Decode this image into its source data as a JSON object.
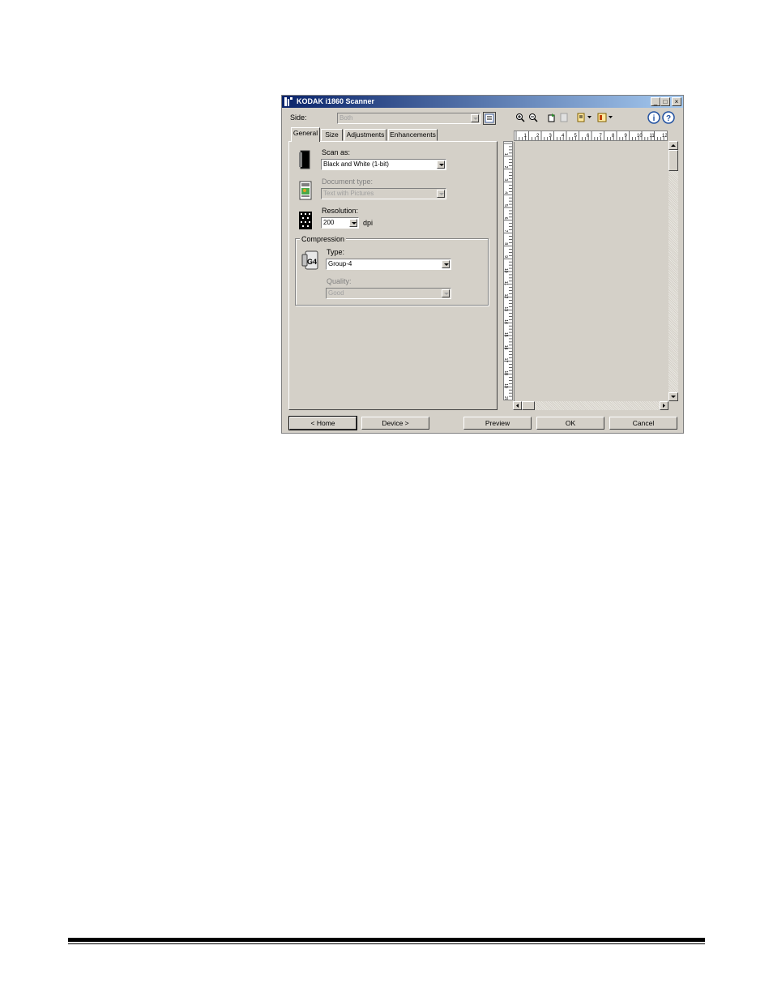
{
  "window": {
    "title": "KODAK i1860 Scanner",
    "minimize": "_",
    "maximize": "□",
    "close": "×"
  },
  "side": {
    "label": "Side:",
    "value": "Both"
  },
  "tabs": [
    {
      "label": "General"
    },
    {
      "label": "Size"
    },
    {
      "label": "Adjustments"
    },
    {
      "label": "Enhancements"
    }
  ],
  "general": {
    "scan_as": {
      "label": "Scan as:",
      "value": "Black and White (1-bit)"
    },
    "document_type": {
      "label": "Document type:",
      "value": "Text with Pictures"
    },
    "resolution": {
      "label": "Resolution:",
      "value": "200",
      "unit": "dpi"
    },
    "compression": {
      "label": "Compression",
      "type": {
        "label": "Type:",
        "value": "Group-4"
      },
      "quality": {
        "label": "Quality:",
        "value": "Good"
      }
    }
  },
  "ruler": {
    "h_ticks": [
      "1",
      "2",
      "3",
      "4",
      "5",
      "6",
      "7",
      "8",
      "9",
      "10",
      "11",
      "12"
    ],
    "v_ticks": [
      "1",
      "2",
      "3",
      "4",
      "5",
      "6",
      "7",
      "8",
      "9",
      "10",
      "11",
      "12",
      "13",
      "14",
      "15",
      "16",
      "17",
      "18",
      "19",
      "20"
    ]
  },
  "buttons": {
    "home": "< Home",
    "device": "Device >",
    "preview": "Preview",
    "ok": "OK",
    "cancel": "Cancel"
  },
  "icons": {
    "zoom_in": "zoom-in-icon",
    "zoom_out": "zoom-out-icon",
    "rotate": "rotate-icon",
    "page": "page-icon",
    "settings": "settings-icon",
    "help": "help-icon"
  },
  "colors": {
    "titlebar_start": "#0a246a",
    "titlebar_end": "#a6caf0",
    "dialog_bg": "#d4d0c8"
  }
}
